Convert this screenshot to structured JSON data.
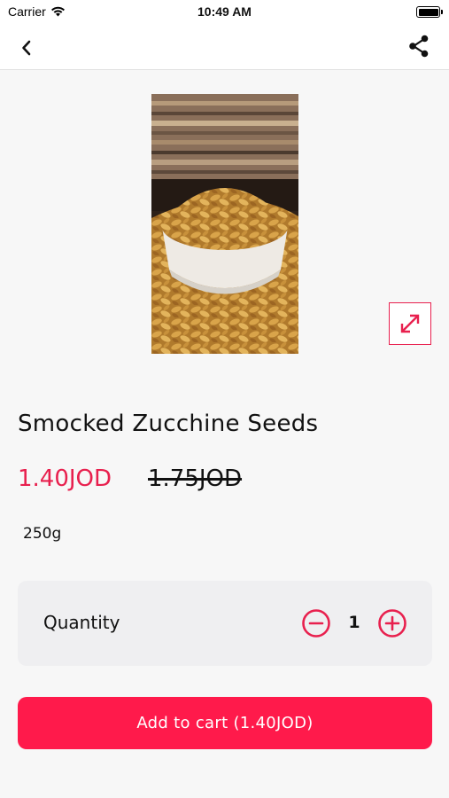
{
  "status_bar": {
    "carrier": "Carrier",
    "time": "10:49 AM"
  },
  "nav": {
    "back_icon": "chevron-left-icon",
    "share_icon": "share-icon"
  },
  "product": {
    "image": "pumpkin-seeds-bowl-photo",
    "expand_icon": "expand-arrows-icon",
    "title": "Smocked Zucchine Seeds",
    "price": "1.40JOD",
    "old_price": "1.75JOD",
    "weight": "250g"
  },
  "quantity": {
    "label": "Quantity",
    "value": "1",
    "minus_icon": "minus-circle-icon",
    "plus_icon": "plus-circle-icon"
  },
  "cart": {
    "button_label": "Add to cart (1.40JOD)"
  },
  "colors": {
    "accent": "#e8204e",
    "button": "#ff1a4b",
    "background": "#f7f7f7",
    "card": "#efeff1"
  }
}
